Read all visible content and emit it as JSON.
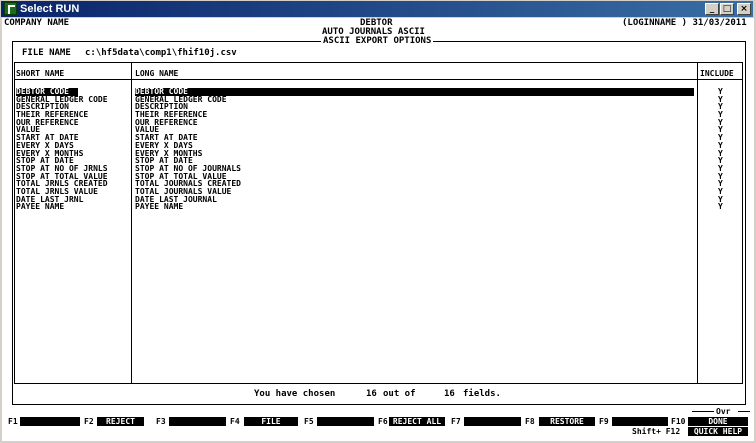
{
  "window": {
    "title": "Select RUN"
  },
  "header": {
    "company": "COMPANY NAME",
    "module": "DEBTOR",
    "login_date": "(LOGINNAME ) 31/03/2011",
    "subtitle1": "AUTO JOURNALS ASCII",
    "subtitle2": "ASCII EXPORT OPTIONS"
  },
  "file": {
    "label": "FILE NAME",
    "value": "c:\\hf5data\\comp1\\fhif10j.csv"
  },
  "columns": {
    "short": "SHORT NAME",
    "long": "LONG NAME",
    "include": "INCLUDE"
  },
  "rows": [
    {
      "short": "DEBTOR CODE",
      "long": "DEBTOR CODE",
      "include": "Y"
    },
    {
      "short": "GENERAL LEDGER CODE",
      "long": "GENERAL LEDGER CODE",
      "include": "Y"
    },
    {
      "short": "DESCRIPTION",
      "long": "DESCRIPTION",
      "include": "Y"
    },
    {
      "short": "THEIR REFERENCE",
      "long": "THEIR REFERENCE",
      "include": "Y"
    },
    {
      "short": "OUR REFERENCE",
      "long": "OUR REFERENCE",
      "include": "Y"
    },
    {
      "short": "VALUE",
      "long": "VALUE",
      "include": "Y"
    },
    {
      "short": "START AT DATE",
      "long": "START AT DATE",
      "include": "Y"
    },
    {
      "short": "EVERY X DAYS",
      "long": "EVERY X DAYS",
      "include": "Y"
    },
    {
      "short": "EVERY X MONTHS",
      "long": "EVERY X MONTHS",
      "include": "Y"
    },
    {
      "short": "STOP AT DATE",
      "long": "STOP AT DATE",
      "include": "Y"
    },
    {
      "short": "STOP AT NO OF JRNLS",
      "long": "STOP AT NO OF JOURNALS",
      "include": "Y"
    },
    {
      "short": "STOP AT TOTAL VALUE",
      "long": "STOP AT TOTAL VALUE",
      "include": "Y"
    },
    {
      "short": "TOTAL JRNLS CREATED",
      "long": "TOTAL JOURNALS CREATED",
      "include": "Y"
    },
    {
      "short": "TOTAL JRNLS VALUE",
      "long": "TOTAL JOURNALS VALUE",
      "include": "Y"
    },
    {
      "short": "DATE LAST JRNL",
      "long": "DATE LAST JOURNAL",
      "include": "Y"
    },
    {
      "short": "PAYEE NAME",
      "long": "PAYEE NAME",
      "include": "Y"
    }
  ],
  "summary": {
    "prefix": "You have chosen",
    "chosen": "16",
    "mid": "out of",
    "total": "16",
    "suffix": "fields."
  },
  "fkeys": {
    "f1": "F1",
    "f2": "F2",
    "f2_label": "REJECT",
    "f3": "F3",
    "f4": "F4",
    "f4_label": "FILE",
    "f5": "F5",
    "f6": "F6",
    "f6_label": "REJECT ALL",
    "f7": "F7",
    "f8": "F8",
    "f8_label": "RESTORE",
    "f9": "F9",
    "f10": "F10",
    "f10_label": "DONE",
    "shift_f12": "Shift+ F12",
    "f12_label": "QUICK HELP",
    "ovr": "Ovr"
  }
}
